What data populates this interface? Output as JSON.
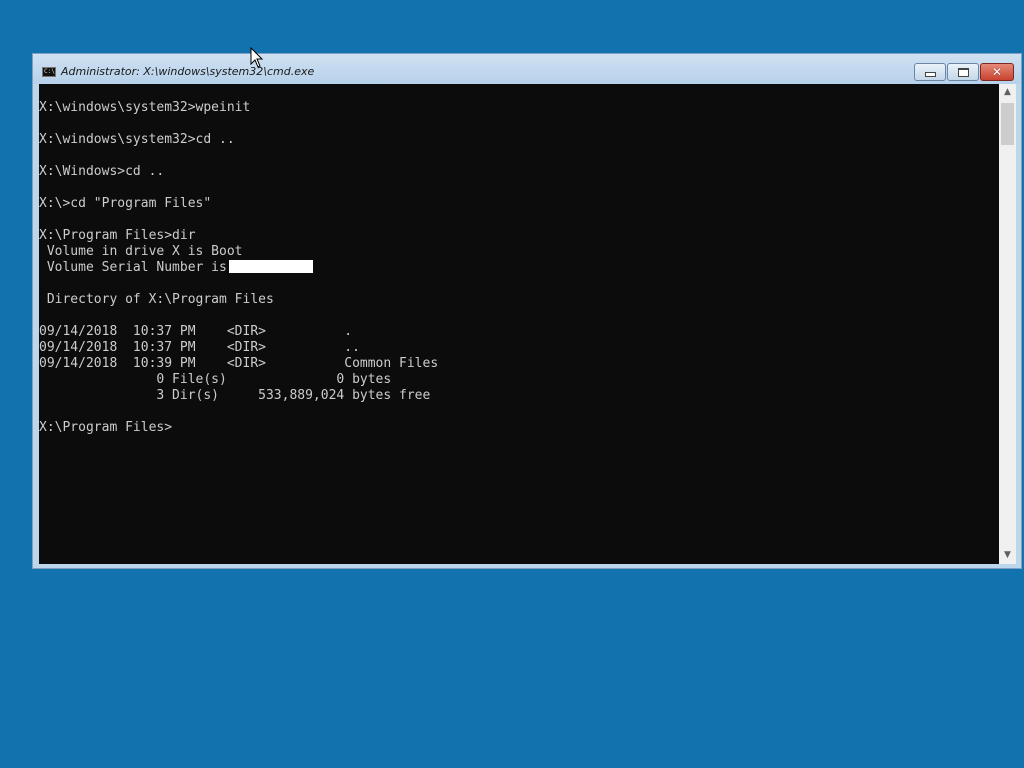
{
  "window": {
    "title": "Administrator: X:\\windows\\system32\\cmd.exe",
    "icon": "cmd-icon",
    "icon_text": "C:\\",
    "controls": {
      "minimize": "minimize-icon",
      "maximize": "maximize-icon",
      "close": "close-icon",
      "close_glyph": "✕"
    }
  },
  "console": {
    "lines": [
      "X:\\windows\\system32>wpeinit",
      "",
      "X:\\windows\\system32>cd ..",
      "",
      "X:\\Windows>cd ..",
      "",
      "X:\\>cd \"Program Files\"",
      "",
      "X:\\Program Files>dir",
      " Volume in drive X is Boot",
      " Volume Serial Number is",
      "",
      " Directory of X:\\Program Files",
      "",
      "09/14/2018  10:37 PM    <DIR>          .",
      "09/14/2018  10:37 PM    <DIR>          ..",
      "09/14/2018  10:39 PM    <DIR>          Common Files",
      "               0 File(s)              0 bytes",
      "               3 Dir(s)     533,889,024 bytes free",
      "",
      "X:\\Program Files>"
    ]
  },
  "scrollbar": {
    "up_glyph": "▲",
    "down_glyph": "▼"
  },
  "colors": {
    "desktop": "#1272ad",
    "console_bg": "#0c0c0c",
    "console_fg": "#cccccc",
    "close_button": "#c8432f"
  }
}
